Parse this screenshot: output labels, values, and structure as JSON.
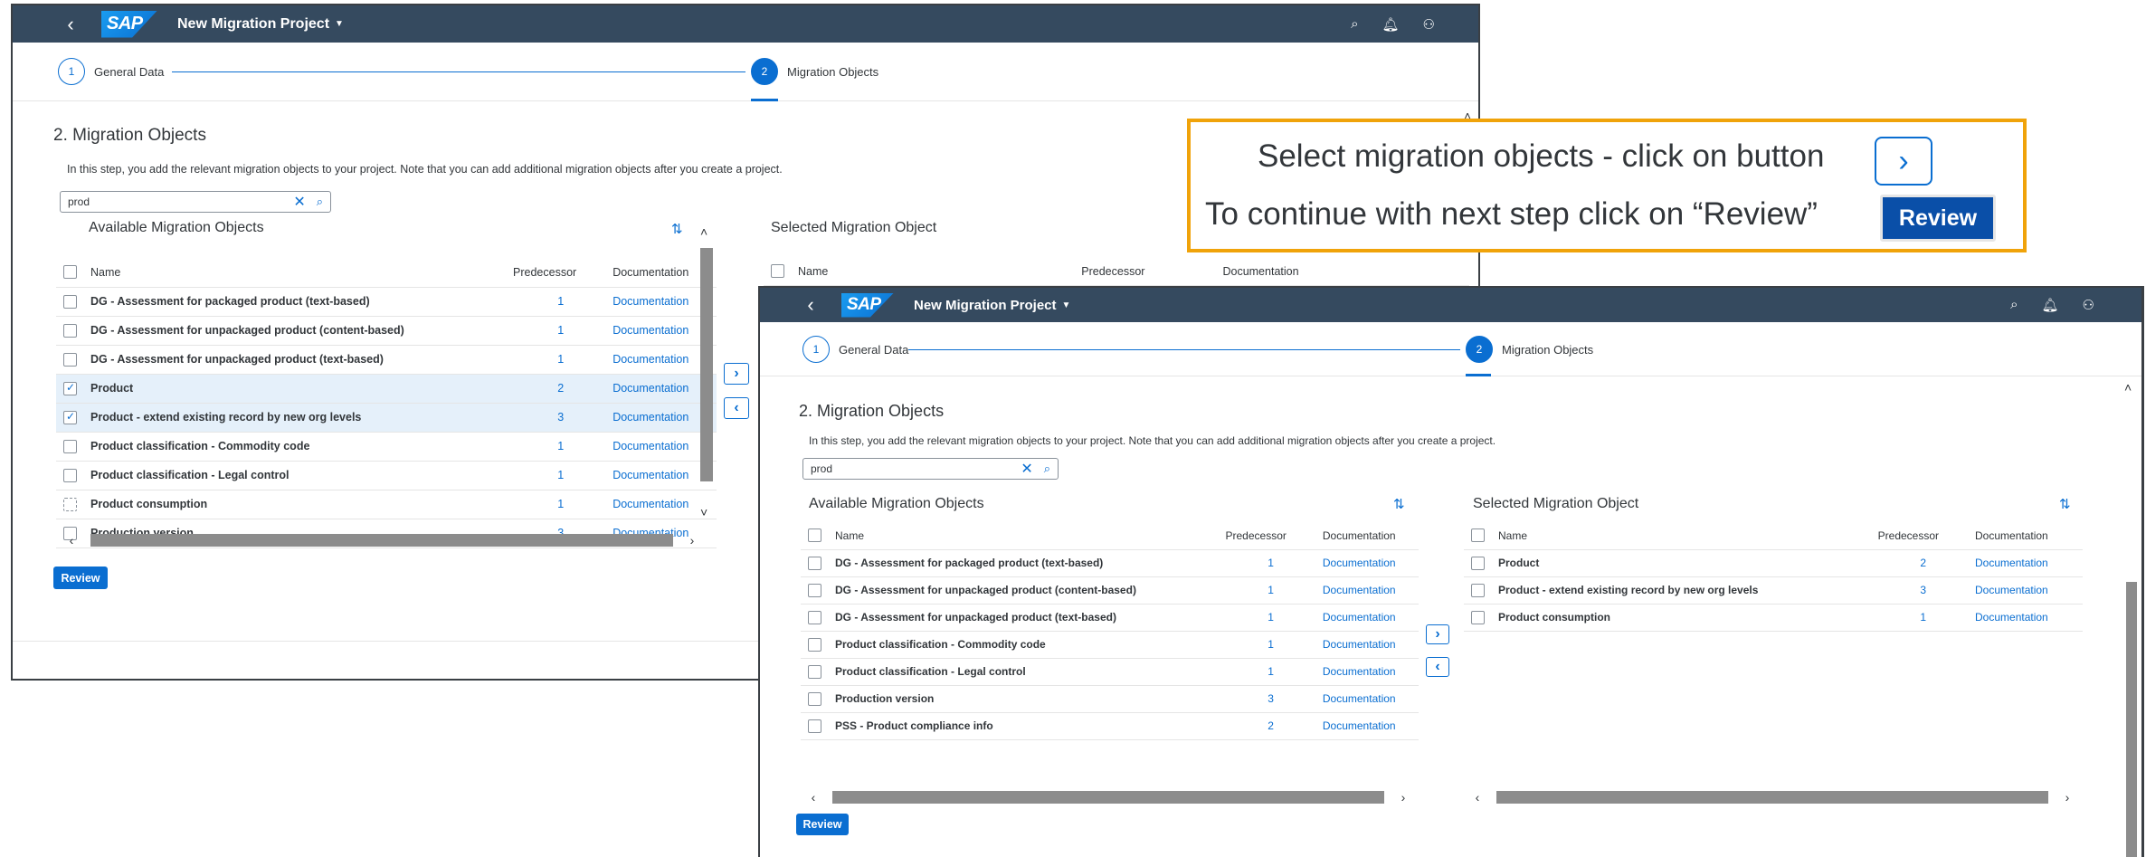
{
  "app": {
    "logo": "SAP",
    "title": "New Migration Project",
    "back_icon": "chevron-left-icon",
    "actions": [
      "search-icon",
      "bell-icon",
      "user-icon"
    ]
  },
  "steps": [
    {
      "num": "1",
      "label": "General Data"
    },
    {
      "num": "2",
      "label": "Migration Objects"
    }
  ],
  "section": {
    "title": "2. Migration Objects",
    "description": "In this step, you add the relevant migration objects to your project. Note that you can add additional migration objects after you create a project."
  },
  "search": {
    "value": "prod",
    "clear": "✕",
    "icon": "⌕"
  },
  "columns": {
    "name": "Name",
    "predecessor": "Predecessor",
    "documentation": "Documentation"
  },
  "panels": {
    "available": "Available Migration Objects",
    "selected": "Selected Migration Object"
  },
  "back_window": {
    "available_rows": [
      {
        "name": "DG - Assessment for packaged product (text-based)",
        "pred": "1",
        "doc": "Documentation",
        "checked": false
      },
      {
        "name": "DG - Assessment for unpackaged product (content-based)",
        "pred": "1",
        "doc": "Documentation",
        "checked": false
      },
      {
        "name": "DG - Assessment for unpackaged product (text-based)",
        "pred": "1",
        "doc": "Documentation",
        "checked": false
      },
      {
        "name": "Product",
        "pred": "2",
        "doc": "Documentation",
        "checked": true
      },
      {
        "name": "Product - extend existing record by new org levels",
        "pred": "3",
        "doc": "Documentation",
        "checked": true
      },
      {
        "name": "Product classification - Commodity code",
        "pred": "1",
        "doc": "Documentation",
        "checked": false
      },
      {
        "name": "Product classification - Legal control",
        "pred": "1",
        "doc": "Documentation",
        "checked": false
      },
      {
        "name": "Product consumption",
        "pred": "1",
        "doc": "Documentation",
        "checked": false
      },
      {
        "name": "Production version",
        "pred": "3",
        "doc": "Documentation",
        "checked": false
      }
    ]
  },
  "front_window": {
    "available_rows": [
      {
        "name": "DG - Assessment for packaged product (text-based)",
        "pred": "1",
        "doc": "Documentation"
      },
      {
        "name": "DG - Assessment for unpackaged product (content-based)",
        "pred": "1",
        "doc": "Documentation"
      },
      {
        "name": "DG - Assessment for unpackaged product (text-based)",
        "pred": "1",
        "doc": "Documentation"
      },
      {
        "name": "Product classification - Commodity code",
        "pred": "1",
        "doc": "Documentation"
      },
      {
        "name": "Product classification - Legal control",
        "pred": "1",
        "doc": "Documentation"
      },
      {
        "name": "Production version",
        "pred": "3",
        "doc": "Documentation"
      },
      {
        "name": "PSS - Product compliance info",
        "pred": "2",
        "doc": "Documentation"
      }
    ],
    "selected_rows": [
      {
        "name": "Product",
        "pred": "2",
        "doc": "Documentation"
      },
      {
        "name": "Product - extend existing record by new org levels",
        "pred": "3",
        "doc": "Documentation"
      },
      {
        "name": "Product consumption",
        "pred": "1",
        "doc": "Documentation"
      }
    ]
  },
  "buttons": {
    "review": "Review",
    "move_right": "›",
    "move_left": "‹",
    "sort": "⇅"
  },
  "callout": {
    "line1": "Select migration objects - click on button",
    "line2": "To continue with next step click on “Review”",
    "button_icon": "›",
    "review": "Review"
  }
}
